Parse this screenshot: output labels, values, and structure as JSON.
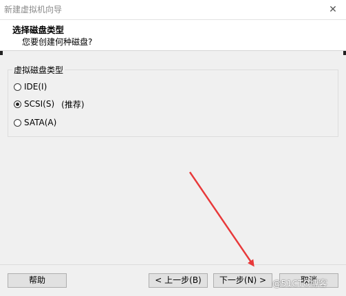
{
  "window": {
    "title": "新建虚拟机向导",
    "close_glyph": "✕"
  },
  "header": {
    "title": "选择磁盘类型",
    "subtitle": "您要创建何种磁盘?"
  },
  "disk_type_group": {
    "legend": "虚拟磁盘类型",
    "options": [
      {
        "label": "IDE(I)",
        "selected": false,
        "note": ""
      },
      {
        "label": "SCSI(S)",
        "selected": true,
        "note": "(推荐)"
      },
      {
        "label": "SATA(A)",
        "selected": false,
        "note": ""
      }
    ]
  },
  "buttons": {
    "help": "帮助",
    "back": "< 上一步(B)",
    "next": "下一步(N) >",
    "cancel": "取消"
  },
  "annotation": {
    "arrow_color": "#e8393a"
  },
  "watermark": "@51CTO博客"
}
